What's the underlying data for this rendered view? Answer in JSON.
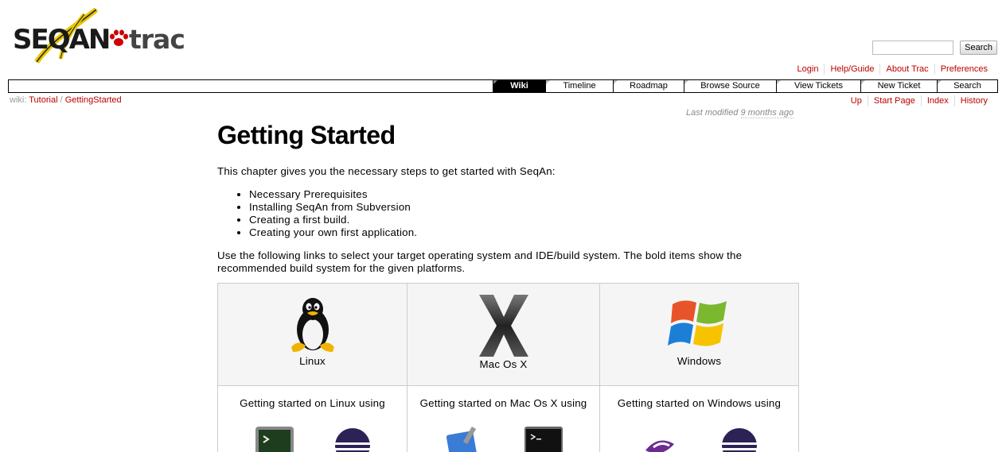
{
  "header": {
    "logo_text": "SEQAN",
    "logo_trac": "trac",
    "search_button": "Search"
  },
  "metanav": [
    "Login",
    "Help/Guide",
    "About Trac",
    "Preferences"
  ],
  "mainnav": [
    "Wiki",
    "Timeline",
    "Roadmap",
    "Browse Source",
    "View Tickets",
    "New Ticket",
    "Search"
  ],
  "breadcrumb": {
    "prefix": "wiki:",
    "items": [
      "Tutorial",
      "GettingStarted"
    ]
  },
  "ctxtnav": [
    "Up",
    "Start Page",
    "Index",
    "History"
  ],
  "last_modified": {
    "prefix": "Last modified",
    "ago": "9 months ago"
  },
  "page": {
    "title": "Getting Started",
    "intro": "This chapter gives you the necessary steps to get started with SeqAn:",
    "steps": [
      "Necessary Prerequisites",
      "Installing SeqAn from Subversion",
      "Creating a first build.",
      "Creating your own first application."
    ],
    "links_text": "Use the following links to select your target operating system and IDE/build system. The bold items show the recommended build system for the given platforms."
  },
  "os_table": [
    {
      "name": "Linux",
      "icon": "tux-penguin-icon",
      "caption": "Getting started on Linux using"
    },
    {
      "name": "Mac Os X",
      "icon": "mac-os-x-icon",
      "caption": "Getting started on Mac Os X using"
    },
    {
      "name": "Windows",
      "icon": "windows-flag-icon",
      "caption": "Getting started on Windows using"
    }
  ]
}
